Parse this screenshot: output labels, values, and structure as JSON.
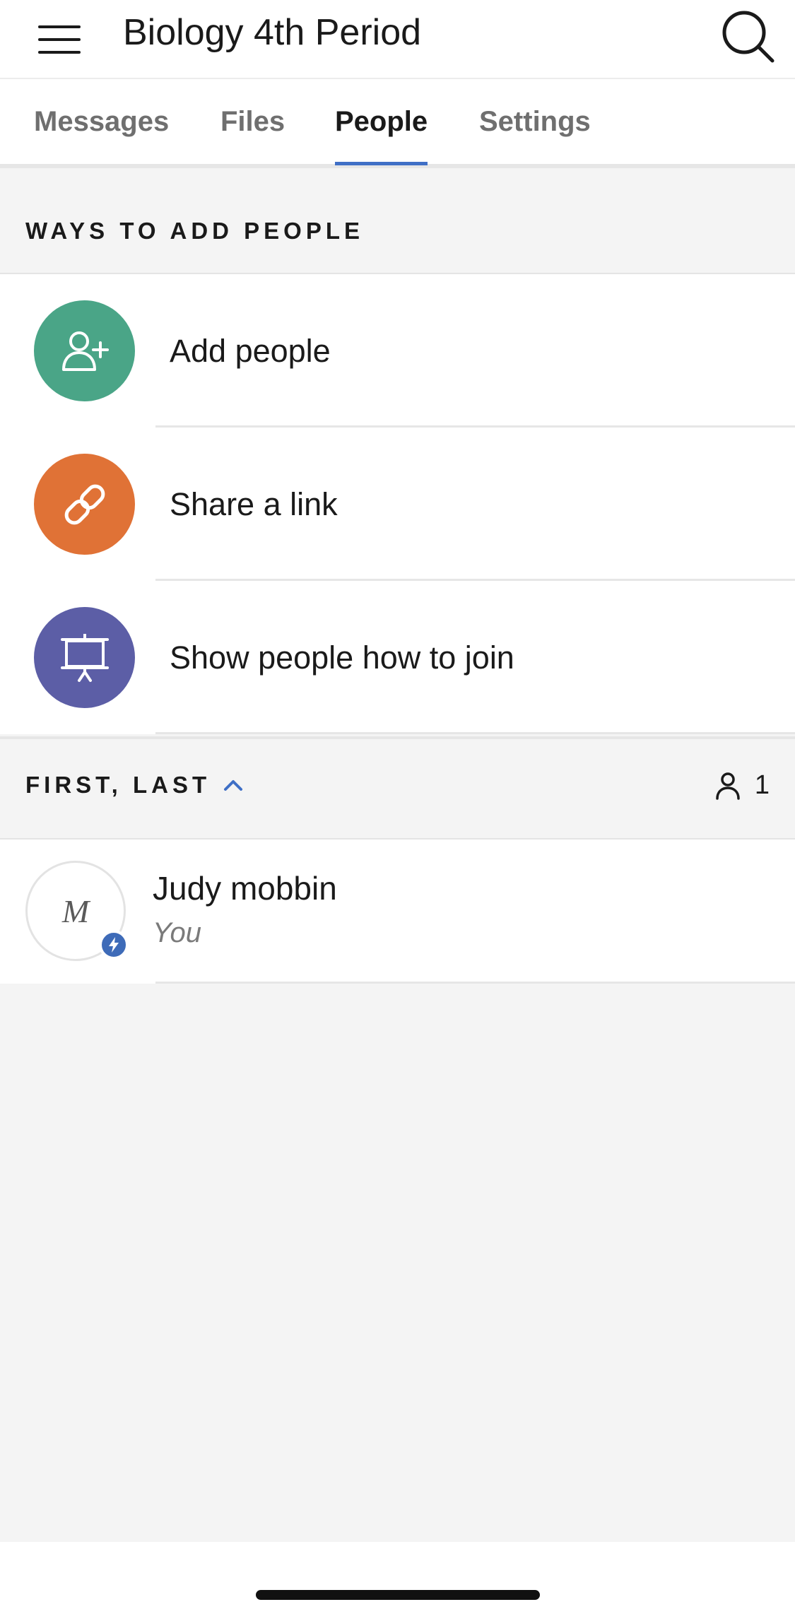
{
  "header": {
    "title": "Biology 4th Period",
    "menu_icon": "hamburger-menu-icon",
    "search_icon": "search-icon"
  },
  "tabs": [
    {
      "label": "Messages",
      "active": false
    },
    {
      "label": "Files",
      "active": false
    },
    {
      "label": "People",
      "active": true
    },
    {
      "label": "Settings",
      "active": false
    }
  ],
  "ways_section": {
    "title": "WAYS TO ADD PEOPLE",
    "items": [
      {
        "label": "Add people",
        "icon": "add-user-icon",
        "color": "#4aa587"
      },
      {
        "label": "Share a link",
        "icon": "link-icon",
        "color": "#e07236"
      },
      {
        "label": "Show people how to join",
        "icon": "presentation-board-icon",
        "color": "#5c5ea6"
      }
    ]
  },
  "people_section": {
    "sort_label": "FIRST, LAST",
    "sort_direction": "ascending",
    "count": "1",
    "members": [
      {
        "initial": "M",
        "name": "Judy mobbin",
        "subtitle": "You",
        "badge_icon": "lightning-icon"
      }
    ]
  },
  "colors": {
    "accent": "#3f6fc6",
    "badge": "#3e6bb8"
  }
}
